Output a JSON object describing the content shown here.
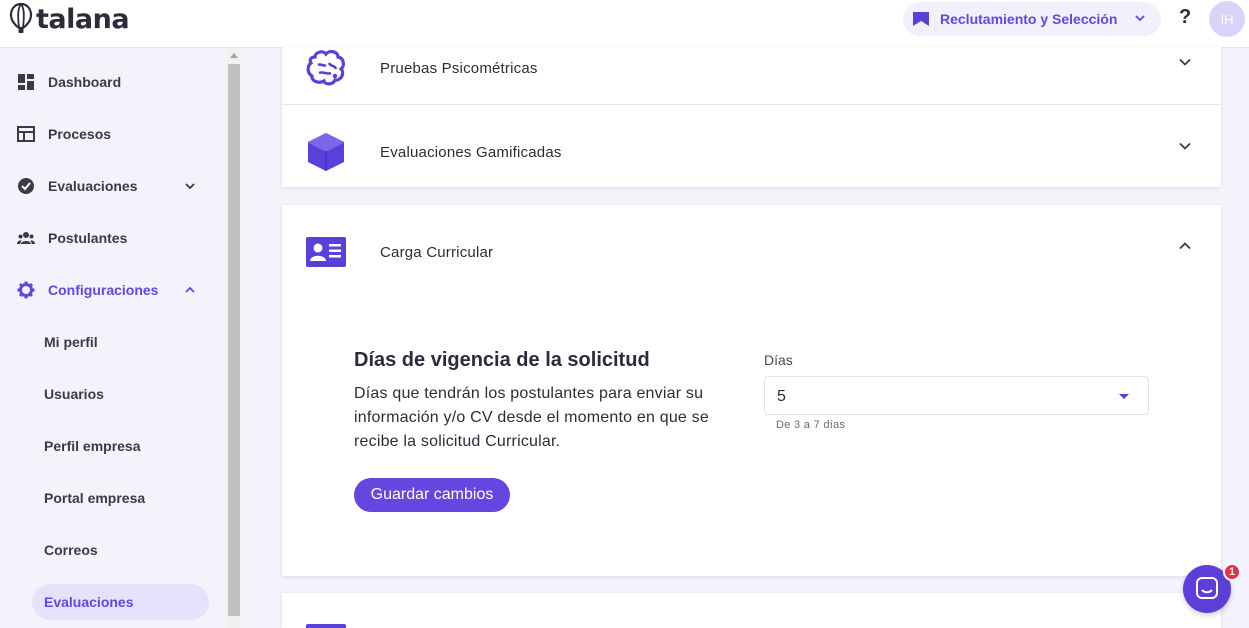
{
  "header": {
    "logo_text": "talana",
    "module_label": "Reclutamiento y Selección",
    "help_label": "?",
    "avatar_initials": "IH"
  },
  "sidebar": {
    "items": [
      {
        "label": "Dashboard",
        "icon": "dashboard-icon"
      },
      {
        "label": "Procesos",
        "icon": "table-icon"
      },
      {
        "label": "Evaluaciones",
        "icon": "check-circle-icon",
        "expandable": true,
        "expanded": false
      },
      {
        "label": "Postulantes",
        "icon": "people-icon"
      },
      {
        "label": "Configuraciones",
        "icon": "gear-icon",
        "expandable": true,
        "expanded": true,
        "active": true
      }
    ],
    "sub_items": [
      {
        "label": "Mi perfil"
      },
      {
        "label": "Usuarios"
      },
      {
        "label": "Perfil empresa"
      },
      {
        "label": "Portal empresa"
      },
      {
        "label": "Correos"
      },
      {
        "label": "Evaluaciones",
        "selected": true
      }
    ]
  },
  "sections": {
    "psychometric": {
      "title": "Pruebas Psicométricas",
      "icon": "brain-icon"
    },
    "gamified": {
      "title": "Evaluaciones Gamificadas",
      "icon": "cube-icon"
    },
    "curricular": {
      "title": "Carga Curricular",
      "icon": "id-card-icon",
      "setting_title": "Días de vigencia de la solicitud",
      "setting_desc": "Días que tendrán los postulantes para enviar su información y/o CV desde el momento en que se recibe la solicitud Curricular.",
      "field_label": "Días",
      "field_value": "5",
      "field_helper": "De 3 a 7 días",
      "save_label": "Guardar cambios"
    }
  },
  "chat": {
    "unread": "1"
  },
  "colors": {
    "accent": "#6446e0",
    "badge": "#e5304a"
  }
}
